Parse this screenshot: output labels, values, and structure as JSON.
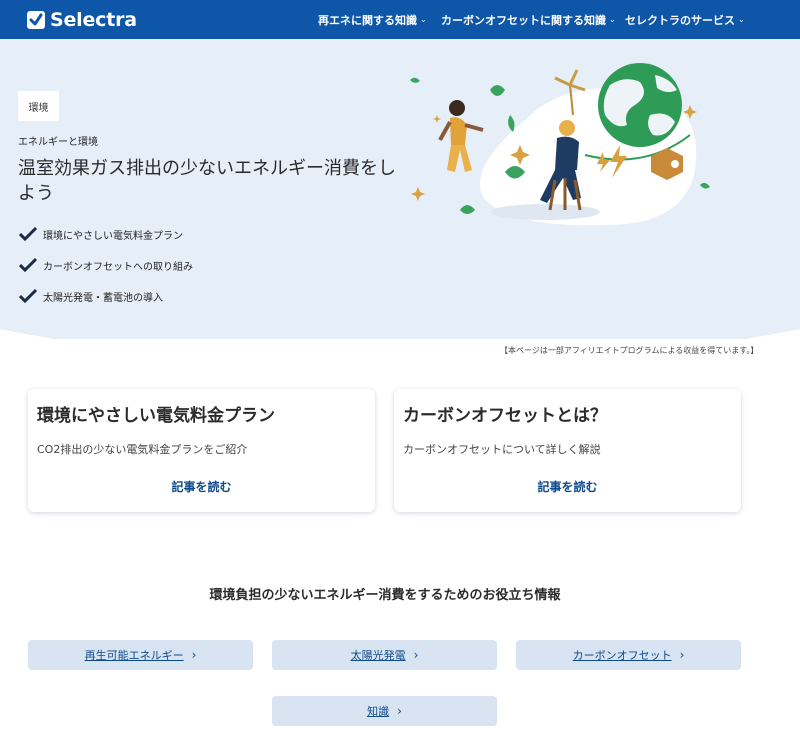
{
  "header": {
    "logo_text": "Selectra",
    "nav": [
      {
        "label": "再エネに関する知識"
      },
      {
        "label": "カーボンオフセットに関する知識"
      },
      {
        "label": "セレクトラのサービス"
      }
    ]
  },
  "hero": {
    "tag": "環境",
    "eyebrow": "エネルギーと環境",
    "title": "温室効果ガス排出の少ないエネルギー消費をしよう",
    "checks": [
      "環境にやさしい電気料金プラン",
      "カーボンオフセットへの取り組み",
      "太陽光発電・蓄電池の導入"
    ]
  },
  "disclaimer": "【本ページは一部アフィリエイトプログラムによる収益を得ています。】",
  "cards": [
    {
      "title": "環境にやさしい電気料金プラン",
      "desc": "CO2排出の少ない電気料金プランをご紹介",
      "link": "記事を読む"
    },
    {
      "title": "カーボンオフセットとは？",
      "desc": "カーボンオフセットについて詳しく解説",
      "link": "記事を読む"
    }
  ],
  "section": {
    "title": "環境負担の少ないエネルギー消費をするためのお役立ち情報",
    "links": [
      {
        "label": "再生可能エネルギー"
      },
      {
        "label": "太陽光発電"
      },
      {
        "label": "カーボンオフセット"
      },
      {
        "label": "知識"
      }
    ]
  },
  "colors": {
    "header_bg": "#0e56a7",
    "hero_bg": "#e6eef8",
    "link": "#0e4a8c",
    "pill_bg": "#d8e4f1"
  }
}
